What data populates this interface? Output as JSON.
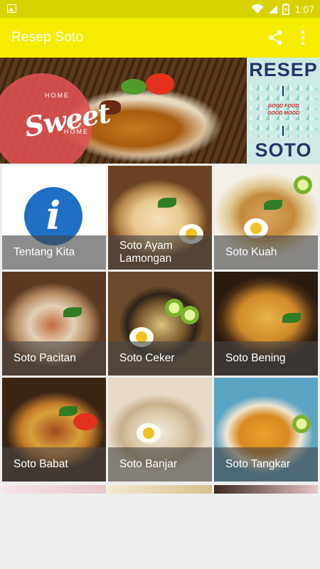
{
  "status_bar": {
    "time": "1:07",
    "icons": [
      "image-icon",
      "wifi-icon",
      "signal-icon",
      "battery-icon"
    ]
  },
  "app_bar": {
    "title": "Resep Soto",
    "actions": [
      "share-icon",
      "more-vert-icon"
    ]
  },
  "banner": {
    "left": {
      "script_text": "Sweet",
      "small_top": "HOME",
      "small_bottom": "HOME"
    },
    "right": {
      "top": "RESEP",
      "bottom": "SOTO",
      "tag1": "GOOD FOOD",
      "tag2": "GOOD MOOD",
      "sep1": "I",
      "sep2": "I"
    }
  },
  "grid": {
    "items": [
      {
        "label": "Tentang Kita",
        "icon": "info-icon"
      },
      {
        "label": "Soto Ayam Lamongan"
      },
      {
        "label": "Soto Kuah"
      },
      {
        "label": "Soto Pacitan"
      },
      {
        "label": "Soto Ceker"
      },
      {
        "label": "Soto Bening"
      },
      {
        "label": "Soto Babat"
      },
      {
        "label": "Soto Banjar"
      },
      {
        "label": "Soto Tangkar"
      }
    ]
  },
  "colors": {
    "status_bar": "#d8d200",
    "app_bar": "#f5ec00",
    "caption_overlay": "#464646",
    "info_blue": "#1f6fc5",
    "background": "#eeeeee"
  }
}
